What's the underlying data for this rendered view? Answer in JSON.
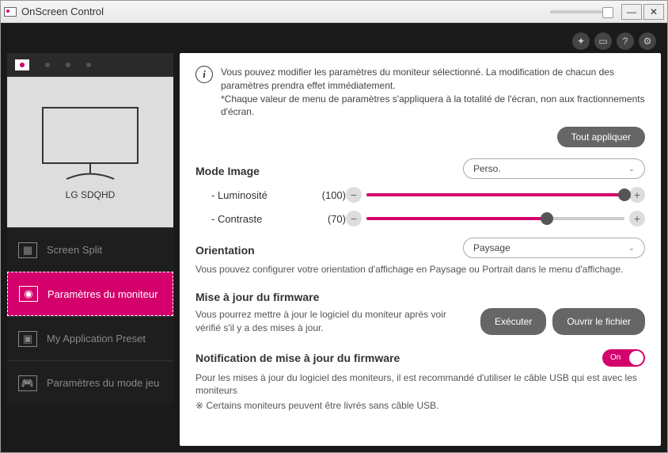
{
  "window": {
    "title": "OnScreen Control"
  },
  "sidebar": {
    "monitor_label": "LG SDQHD",
    "items": [
      {
        "label": "Screen Split"
      },
      {
        "label": "Paramètres du moniteur"
      },
      {
        "label": "My Application Preset"
      },
      {
        "label": "Paramètres du mode jeu"
      }
    ]
  },
  "panel": {
    "info_line1": "Vous pouvez modifier les paramètres du moniteur sélectionné. La modification de chacun des paramètres prendra effet immédiatement.",
    "info_line2": "*Chaque valeur de menu de paramètres s'appliquera à la totalité de l'écran, non aux fractionnements d'écran.",
    "apply_all": "Tout appliquer",
    "mode_image": {
      "label": "Mode Image",
      "value": "Perso."
    },
    "brightness": {
      "label": "- Luminosité",
      "value": 100,
      "display": "(100)"
    },
    "contrast": {
      "label": "- Contraste",
      "value": 70,
      "display": "(70)"
    },
    "orientation": {
      "label": "Orientation",
      "value": "Paysage",
      "desc": "Vous pouvez configurer votre orientation d'affichage en Paysage ou Portrait dans le menu d'affichage."
    },
    "firmware": {
      "title": "Mise à jour du firmware",
      "desc": "Vous pourrez mettre à jour le logiciel du moniteur après voir vérifié s'il y a des mises à jour.",
      "execute": "Exécuter",
      "open_file": "Ouvrir le fichier"
    },
    "notification": {
      "title": "Notification de mise à jour du firmware",
      "state": "On",
      "desc1": "Pour les mises à jour du logiciel des moniteurs, il est recommandé d'utiliser le câble USB qui est avec les moniteurs",
      "desc2": "※ Certains moniteurs peuvent être livrés sans câble USB."
    }
  }
}
